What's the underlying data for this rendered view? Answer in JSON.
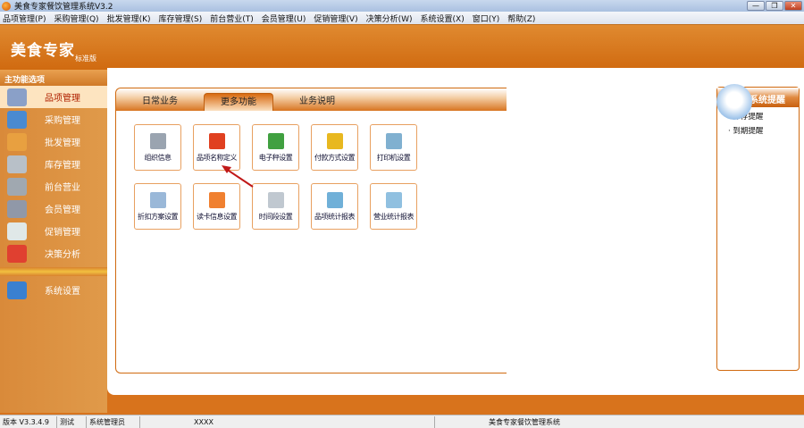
{
  "window": {
    "title": "美食专家餐饮管理系统V3.2",
    "minimize": "—",
    "restore": "❐",
    "close": "✕"
  },
  "menu": [
    "品项管理(P)",
    "采购管理(Q)",
    "批发管理(K)",
    "库存管理(S)",
    "前台营业(T)",
    "会员管理(U)",
    "促销管理(V)",
    "决策分析(W)",
    "系统设置(X)",
    "窗口(Y)",
    "帮助(Z)"
  ],
  "logo": {
    "name": "美食专家",
    "edition": "标准版"
  },
  "sidebar": {
    "title": "主功能选项",
    "items": [
      {
        "label": "品项管理",
        "icon": "building-pencil-icon",
        "color": "#8aa0c8"
      },
      {
        "label": "采购管理",
        "icon": "form-pencil-icon",
        "color": "#4a8ad0"
      },
      {
        "label": "批发管理",
        "icon": "truck-arrow-icon",
        "color": "#e8a040"
      },
      {
        "label": "库存管理",
        "icon": "database-add-icon",
        "color": "#b8c0c8"
      },
      {
        "label": "前台营业",
        "icon": "cart-arrow-icon",
        "color": "#a0a8b0"
      },
      {
        "label": "会员管理",
        "icon": "member-card-icon",
        "color": "#9098a8"
      },
      {
        "label": "促销管理",
        "icon": "line-chart-icon",
        "color": "#e0e8e8"
      },
      {
        "label": "决策分析",
        "icon": "pie-chart-icon",
        "color": "#e04030"
      }
    ],
    "bottom": {
      "label": "系统设置",
      "icon": "computer-add-icon",
      "color": "#3a80d0"
    }
  },
  "tabs": [
    {
      "label": "日常业务",
      "active": false
    },
    {
      "label": "更多功能",
      "active": true
    },
    {
      "label": "业务说明",
      "active": false
    }
  ],
  "tiles": [
    {
      "label": "组织信息",
      "icon": "printer-icon",
      "color": "#9aa4b0"
    },
    {
      "label": "品项名称定义",
      "icon": "windows-icon",
      "color": "#e04020"
    },
    {
      "label": "电子秤设置",
      "icon": "scale-icon",
      "color": "#40a040"
    },
    {
      "label": "付款方式设置",
      "icon": "coins-icon",
      "color": "#e8b820"
    },
    {
      "label": "打印机设置",
      "icon": "triangle-arrow-icon",
      "color": "#80b0d0"
    },
    {
      "label": "折扣方案设置",
      "icon": "windows-stack-icon",
      "color": "#9ab8d8"
    },
    {
      "label": "读卡信息设置",
      "icon": "rss-card-icon",
      "color": "#f08030"
    },
    {
      "label": "时间段设置",
      "icon": "calendar-warning-icon",
      "color": "#c0c8d0"
    },
    {
      "label": "品项统计报表",
      "icon": "report-excel-icon",
      "color": "#70b0d8"
    },
    {
      "label": "营业统计报表",
      "icon": "report-arrows-icon",
      "color": "#90c0e0"
    }
  ],
  "reminders": {
    "title": "系统提醒",
    "items": [
      "· 库存提醒",
      "· 到期提醒"
    ]
  },
  "status": [
    "版本 V3.3.4.9",
    "测试",
    "系统管理员",
    "XXXX",
    "美食专家餐饮管理系统"
  ]
}
